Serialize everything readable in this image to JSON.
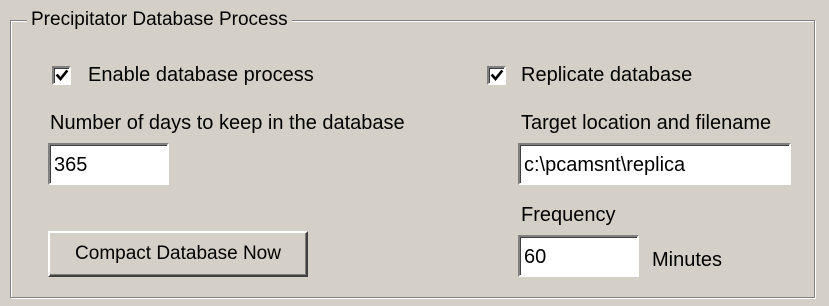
{
  "group": {
    "title": "Precipitator Database Process"
  },
  "enable_process": {
    "label": "Enable database process",
    "checked": true
  },
  "days_keep": {
    "label": "Number of days to keep in the database",
    "value": "365"
  },
  "compact_button": {
    "label": "Compact Database Now"
  },
  "replicate": {
    "label": "Replicate database",
    "checked": true
  },
  "target": {
    "label": "Target location and filename",
    "value": "c:\\pcamsnt\\replica"
  },
  "frequency": {
    "label": "Frequency",
    "value": "60",
    "unit": "Minutes"
  }
}
